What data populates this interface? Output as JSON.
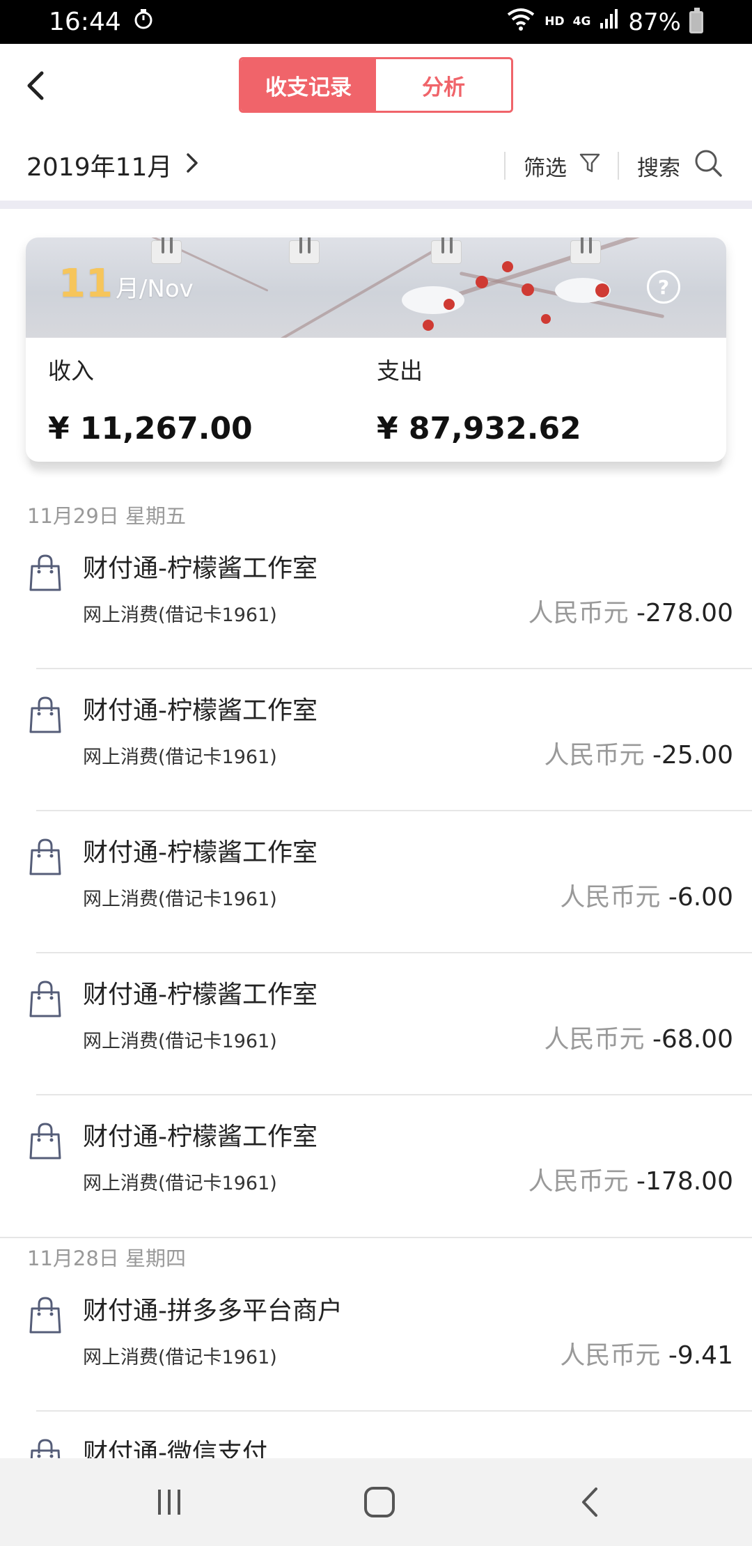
{
  "status_bar": {
    "time": "16:44",
    "hd": "HD",
    "network": "4G",
    "battery": "87%"
  },
  "header": {
    "tabs": [
      "收支记录",
      "分析"
    ],
    "active_tab": 0
  },
  "filter_row": {
    "month": "2019年11月",
    "filter_label": "筛选",
    "search_label": "搜索"
  },
  "summary": {
    "banner_month_num": "11",
    "banner_month_text": "月/Nov",
    "help": "?",
    "income_label": "收入",
    "income_value": "¥ 11,267.00",
    "expense_label": "支出",
    "expense_value": "¥ 87,932.62"
  },
  "groups": [
    {
      "date": "11月29日 星期五",
      "items": [
        {
          "title": "财付通-柠檬酱工作室",
          "sub": "网上消费(借记卡1961)",
          "currency": "人民币元",
          "amount": "-278.00"
        },
        {
          "title": "财付通-柠檬酱工作室",
          "sub": "网上消费(借记卡1961)",
          "currency": "人民币元",
          "amount": "-25.00"
        },
        {
          "title": "财付通-柠檬酱工作室",
          "sub": "网上消费(借记卡1961)",
          "currency": "人民币元",
          "amount": "-6.00"
        },
        {
          "title": "财付通-柠檬酱工作室",
          "sub": "网上消费(借记卡1961)",
          "currency": "人民币元",
          "amount": "-68.00"
        },
        {
          "title": "财付通-柠檬酱工作室",
          "sub": "网上消费(借记卡1961)",
          "currency": "人民币元",
          "amount": "-178.00"
        }
      ]
    },
    {
      "date": "11月28日 星期四",
      "items": [
        {
          "title": "财付通-拼多多平台商户",
          "sub": "网上消费(借记卡1961)",
          "currency": "人民币元",
          "amount": "-9.41"
        },
        {
          "title": "财付通-微信支付",
          "sub": "",
          "currency": "",
          "amount": ""
        }
      ]
    }
  ],
  "colors": {
    "accent": "#f0646a",
    "muted": "#999999",
    "band": "#ecebf3"
  }
}
